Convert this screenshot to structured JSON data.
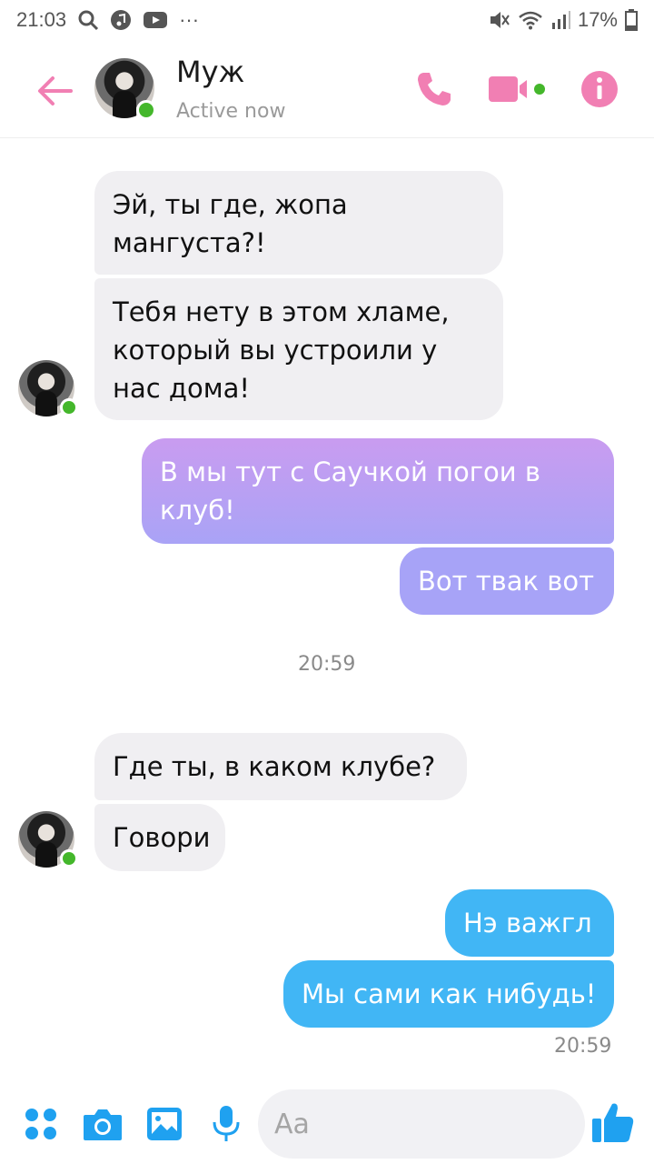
{
  "status_bar": {
    "time": "21:03",
    "battery": "17%"
  },
  "header": {
    "name": "Муж",
    "status": "Active now",
    "accent_color": "#f17fb3",
    "online_color": "#44b72b"
  },
  "messages": [
    {
      "text": "Эй, ты где, жопа мангуста?!",
      "sender": "contact"
    },
    {
      "text": "Тебя нету в этом хламе, который вы устроили у нас дома!",
      "sender": "contact"
    },
    {
      "text": "В мы тут с Саучкой погои в клуб!",
      "sender": "me"
    },
    {
      "text": "Вот твак вот",
      "sender": "me"
    },
    {
      "text": "Где ты, в каком клубе?",
      "sender": "contact"
    },
    {
      "text": "Говори",
      "sender": "contact"
    },
    {
      "text": "Нэ важгл",
      "sender": "me"
    },
    {
      "text": "Мы сами как нибудь!",
      "sender": "me"
    }
  ],
  "timestamps": {
    "divider": "20:59",
    "last_sent": "20:59"
  },
  "composer": {
    "placeholder": "Aa",
    "icon_color": "#1fa1f0"
  }
}
